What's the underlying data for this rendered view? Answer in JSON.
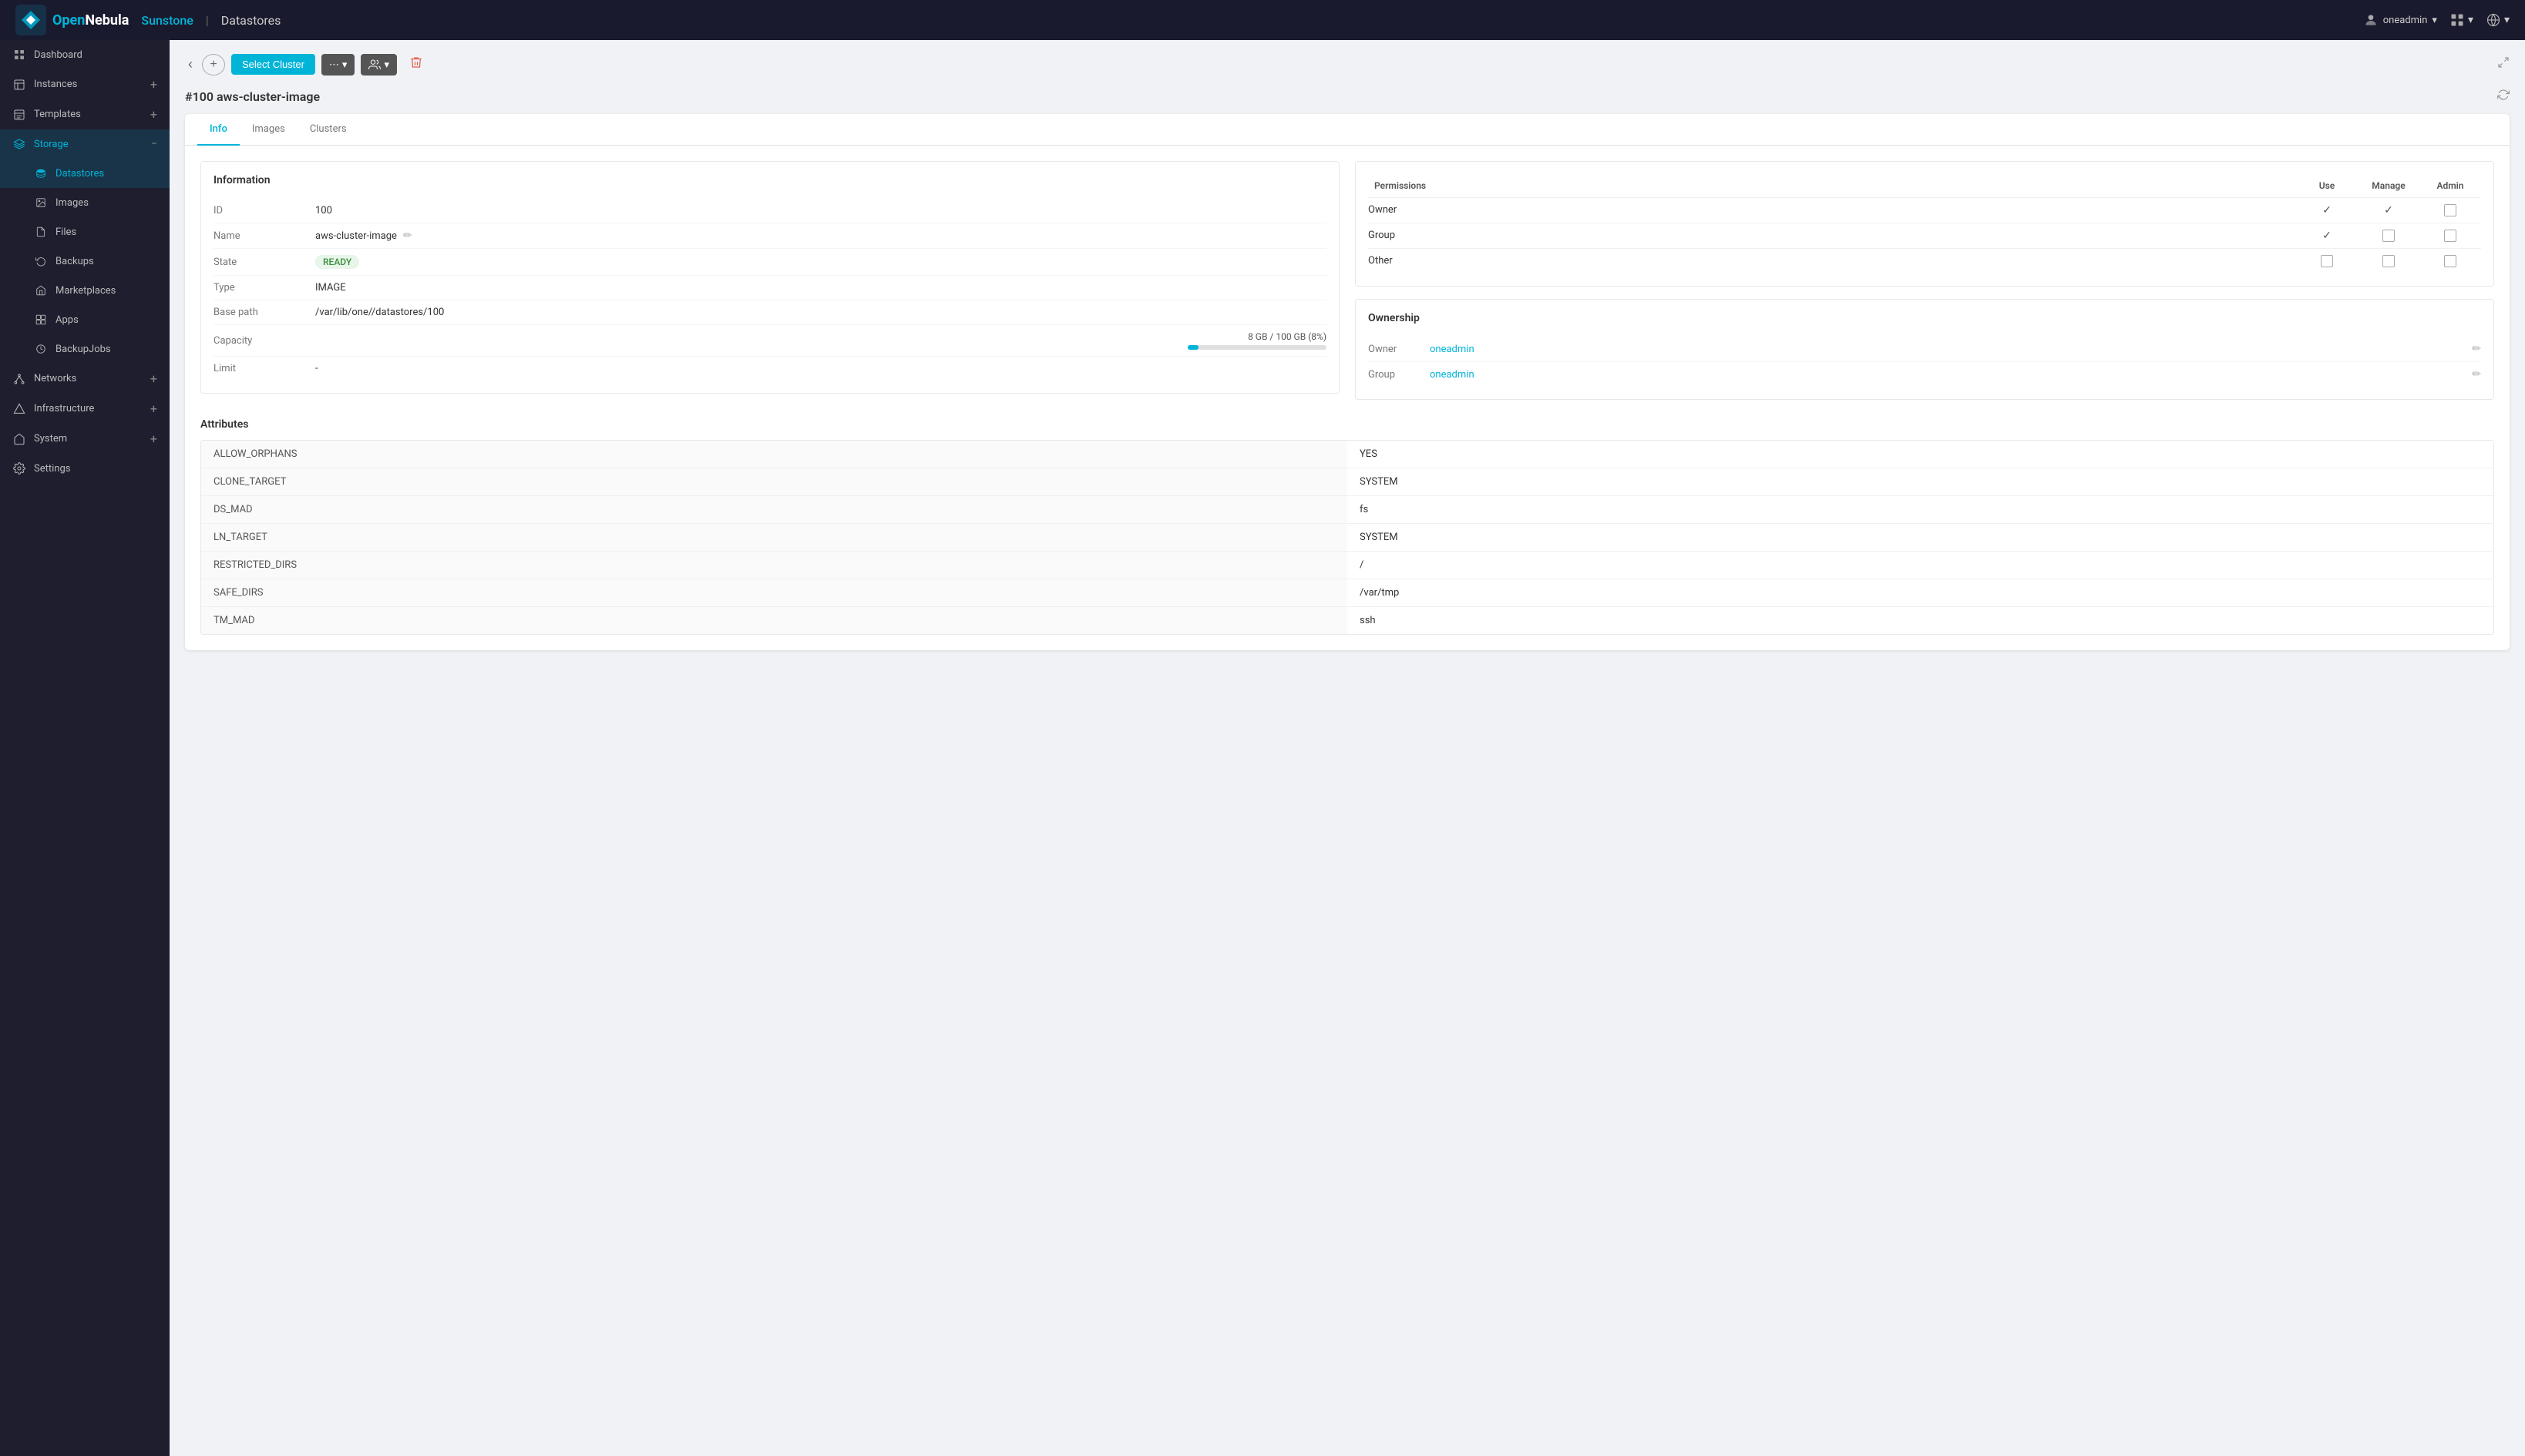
{
  "topbar": {
    "title": "Sunstone",
    "separator": "|",
    "section": "Datastores",
    "user": "oneadmin",
    "collapse_label": "‹"
  },
  "sidebar": {
    "items": [
      {
        "id": "dashboard",
        "label": "Dashboard",
        "icon": "⊞",
        "has_add": false,
        "active": false
      },
      {
        "id": "instances",
        "label": "Instances",
        "icon": "▦",
        "has_add": true,
        "active": false
      },
      {
        "id": "templates",
        "label": "Templates",
        "icon": "☰",
        "has_add": true,
        "active": false
      },
      {
        "id": "storage",
        "label": "Storage",
        "icon": "☁",
        "has_add": false,
        "active": true,
        "expanded": true
      },
      {
        "id": "datastores",
        "label": "Datastores",
        "icon": "●",
        "has_add": false,
        "active": true,
        "sub": true
      },
      {
        "id": "images",
        "label": "Images",
        "icon": "◉",
        "has_add": false,
        "active": false,
        "sub": true
      },
      {
        "id": "files",
        "label": "Files",
        "icon": "☰",
        "has_add": false,
        "active": false,
        "sub": true
      },
      {
        "id": "backups",
        "label": "Backups",
        "icon": "↺",
        "has_add": false,
        "active": false,
        "sub": true
      },
      {
        "id": "marketplaces",
        "label": "Marketplaces",
        "icon": "◈",
        "has_add": false,
        "active": false,
        "sub": true
      },
      {
        "id": "apps",
        "label": "Apps",
        "icon": "◱",
        "has_add": false,
        "active": false,
        "sub": true
      },
      {
        "id": "backupjobs",
        "label": "BackupJobs",
        "icon": "⊙",
        "has_add": false,
        "active": false,
        "sub": true
      },
      {
        "id": "networks",
        "label": "Networks",
        "icon": "◈",
        "has_add": true,
        "active": false
      },
      {
        "id": "infrastructure",
        "label": "Infrastructure",
        "icon": "⬡",
        "has_add": true,
        "active": false
      },
      {
        "id": "system",
        "label": "System",
        "icon": "⌂",
        "has_add": true,
        "active": false
      },
      {
        "id": "settings",
        "label": "Settings",
        "icon": "⚙",
        "has_add": false,
        "active": false
      }
    ]
  },
  "toolbar": {
    "back_label": "‹",
    "select_cluster_label": "Select Cluster",
    "options_label": "⋯",
    "users_label": "👥",
    "delete_icon": "🗑"
  },
  "page": {
    "title": "#100 aws-cluster-image",
    "refresh_icon": "↻"
  },
  "tabs": [
    {
      "id": "info",
      "label": "Info",
      "active": true
    },
    {
      "id": "images",
      "label": "Images",
      "active": false
    },
    {
      "id": "clusters",
      "label": "Clusters",
      "active": false
    }
  ],
  "information": {
    "title": "Information",
    "fields": [
      {
        "label": "ID",
        "value": "100",
        "editable": false
      },
      {
        "label": "Name",
        "value": "aws-cluster-image",
        "editable": true
      },
      {
        "label": "State",
        "value": "READY",
        "type": "badge"
      },
      {
        "label": "Type",
        "value": "IMAGE",
        "editable": false
      },
      {
        "label": "Base path",
        "value": "/var/lib/one//datastores/100",
        "editable": false
      },
      {
        "label": "Capacity",
        "value": "8 GB / 100 GB (8%)",
        "type": "progress",
        "percent": 8
      },
      {
        "label": "Limit",
        "value": "-",
        "editable": false
      }
    ]
  },
  "permissions": {
    "title": "Permissions",
    "columns": [
      "Permissions",
      "Use",
      "Manage",
      "Admin"
    ],
    "rows": [
      {
        "label": "Owner",
        "use": true,
        "use_type": "check",
        "manage": true,
        "manage_type": "check",
        "admin": false,
        "admin_type": "checkbox"
      },
      {
        "label": "Group",
        "use": true,
        "use_type": "check",
        "manage": false,
        "manage_type": "checkbox",
        "admin": false,
        "admin_type": "checkbox"
      },
      {
        "label": "Other",
        "use": false,
        "use_type": "checkbox",
        "manage": false,
        "manage_type": "checkbox",
        "admin": false,
        "admin_type": "checkbox"
      }
    ]
  },
  "ownership": {
    "title": "Ownership",
    "rows": [
      {
        "label": "Owner",
        "value": "oneadmin"
      },
      {
        "label": "Group",
        "value": "oneadmin"
      }
    ]
  },
  "attributes": {
    "title": "Attributes",
    "rows": [
      {
        "key": "ALLOW_ORPHANS",
        "value": "YES"
      },
      {
        "key": "CLONE_TARGET",
        "value": "SYSTEM"
      },
      {
        "key": "DS_MAD",
        "value": "fs"
      },
      {
        "key": "LN_TARGET",
        "value": "SYSTEM"
      },
      {
        "key": "RESTRICTED_DIRS",
        "value": "/"
      },
      {
        "key": "SAFE_DIRS",
        "value": "/var/tmp"
      },
      {
        "key": "TM_MAD",
        "value": "ssh"
      }
    ]
  },
  "colors": {
    "accent": "#00b4d8",
    "sidebar_bg": "#1e1e2f",
    "topbar_bg": "#1a1a2e",
    "active_item": "#00b4d8"
  }
}
